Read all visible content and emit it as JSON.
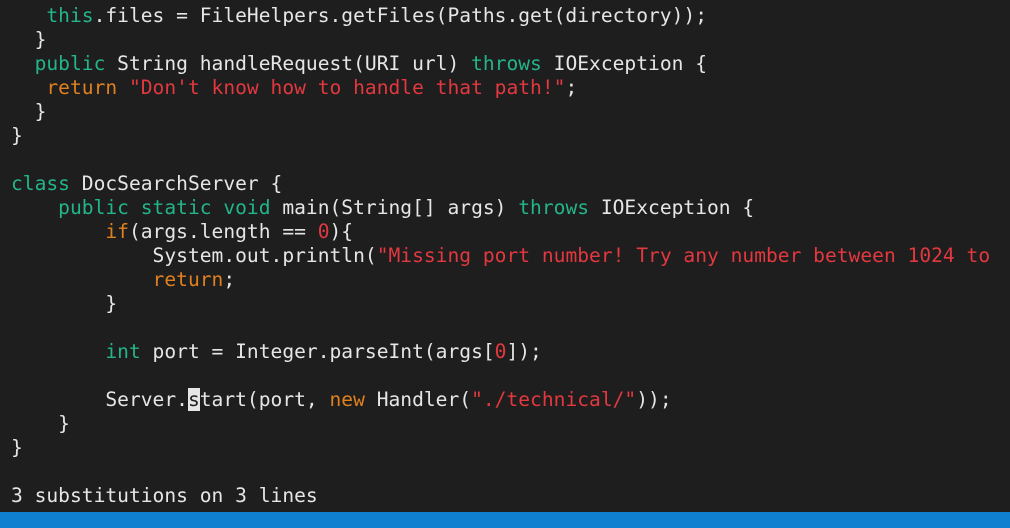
{
  "editor": {
    "lines": [
      {
        "indent": "",
        "tokens": [
          {
            "t": "   this",
            "c": "kw-green"
          },
          {
            "t": ".files = FileHelpers.getFiles(Paths.get(directory));",
            "c": "text"
          }
        ]
      },
      {
        "indent": "",
        "tokens": [
          {
            "t": "  }",
            "c": "text"
          }
        ]
      },
      {
        "indent": "",
        "tokens": [
          {
            "t": "  public",
            "c": "kw-green"
          },
          {
            "t": " String handleRequest(URI url) ",
            "c": "text"
          },
          {
            "t": "throws",
            "c": "kw-green"
          },
          {
            "t": " IOException {",
            "c": "text"
          }
        ]
      },
      {
        "indent": "",
        "tokens": [
          {
            "t": "   return",
            "c": "kw-orange"
          },
          {
            "t": " ",
            "c": "text"
          },
          {
            "t": "\"Don't know how to handle that path!\"",
            "c": "string"
          },
          {
            "t": ";",
            "c": "text"
          }
        ]
      },
      {
        "indent": "",
        "tokens": [
          {
            "t": "  }",
            "c": "text"
          }
        ]
      },
      {
        "indent": "",
        "tokens": [
          {
            "t": "}",
            "c": "text"
          }
        ]
      },
      {
        "indent": "",
        "tokens": []
      },
      {
        "indent": "",
        "tokens": [
          {
            "t": "class",
            "c": "kw-green"
          },
          {
            "t": " DocSearchServer {",
            "c": "text"
          }
        ]
      },
      {
        "indent": "",
        "tokens": [
          {
            "t": "    public static void",
            "c": "kw-green"
          },
          {
            "t": " main(String[] args) ",
            "c": "text"
          },
          {
            "t": "throws",
            "c": "kw-green"
          },
          {
            "t": " IOException {",
            "c": "text"
          }
        ]
      },
      {
        "indent": "",
        "tokens": [
          {
            "t": "        if",
            "c": "kw-orange"
          },
          {
            "t": "(args.length == ",
            "c": "text"
          },
          {
            "t": "0",
            "c": "number"
          },
          {
            "t": "){",
            "c": "text"
          }
        ]
      },
      {
        "indent": "",
        "tokens": [
          {
            "t": "            System.out.println(",
            "c": "text"
          },
          {
            "t": "\"Missing port number! Try any number between 1024 to",
            "c": "string"
          }
        ]
      },
      {
        "indent": "",
        "tokens": [
          {
            "t": "            return",
            "c": "kw-orange"
          },
          {
            "t": ";",
            "c": "text"
          }
        ]
      },
      {
        "indent": "",
        "tokens": [
          {
            "t": "        }",
            "c": "text"
          }
        ]
      },
      {
        "indent": "",
        "tokens": []
      },
      {
        "indent": "",
        "tokens": [
          {
            "t": "        int",
            "c": "kw-green"
          },
          {
            "t": " port = Integer.parseInt(args[",
            "c": "text"
          },
          {
            "t": "0",
            "c": "number"
          },
          {
            "t": "]);",
            "c": "text"
          }
        ]
      },
      {
        "indent": "",
        "tokens": []
      },
      {
        "indent": "",
        "tokens": [
          {
            "t": "        Server.",
            "c": "text"
          },
          {
            "t": "s",
            "c": "cursor"
          },
          {
            "t": "tart(port, ",
            "c": "text"
          },
          {
            "t": "new",
            "c": "kw-orange"
          },
          {
            "t": " Handler(",
            "c": "text"
          },
          {
            "t": "\"./technical/\"",
            "c": "string"
          },
          {
            "t": "));",
            "c": "text"
          }
        ]
      },
      {
        "indent": "",
        "tokens": [
          {
            "t": "    }",
            "c": "text"
          }
        ]
      },
      {
        "indent": "",
        "tokens": [
          {
            "t": "}",
            "c": "text"
          }
        ]
      }
    ]
  },
  "command_line": {
    "message": "3 substitutions on 3 lines"
  },
  "colors": {
    "background": "#1e1e1e",
    "keyword_green": "#23b589",
    "keyword_orange": "#e0801e",
    "string_red": "#e3383f",
    "text": "#e6e6e6",
    "bottom_bar": "#0f7fd0"
  }
}
